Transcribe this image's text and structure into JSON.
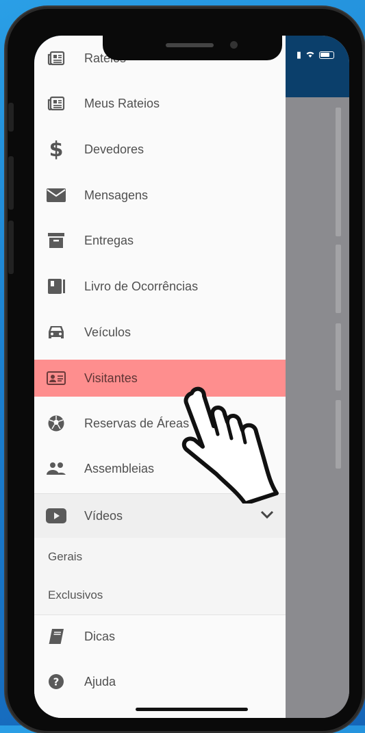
{
  "menu": {
    "items": [
      {
        "label": "Rateios",
        "icon": "newspaper-icon"
      },
      {
        "label": "Meus Rateios",
        "icon": "newspaper-icon"
      },
      {
        "label": "Devedores",
        "icon": "dollar-icon"
      },
      {
        "label": "Mensagens",
        "icon": "envelope-icon"
      },
      {
        "label": "Entregas",
        "icon": "archive-box-icon"
      },
      {
        "label": "Livro de Ocorrências",
        "icon": "book-icon"
      },
      {
        "label": "Veículos",
        "icon": "car-icon"
      },
      {
        "label": "Visitantes",
        "icon": "id-card-icon"
      },
      {
        "label": "Reservas de Áreas",
        "icon": "soccer-ball-icon"
      },
      {
        "label": "Assembleias",
        "icon": "people-icon"
      }
    ],
    "videos": {
      "label": "Vídeos",
      "icon": "youtube-icon",
      "expanded": true,
      "subitems": [
        "Gerais",
        "Exclusivos"
      ]
    },
    "bottom_items": [
      {
        "label": "Dicas",
        "icon": "notebook-icon"
      },
      {
        "label": "Ajuda",
        "icon": "question-circle-icon"
      }
    ],
    "selected_item": "Visitantes"
  },
  "colors": {
    "highlight": "#ff6b6b",
    "header": "#0b3f6b",
    "drawer_bg": "#fafafa",
    "overlay": "#8b8b8f"
  }
}
